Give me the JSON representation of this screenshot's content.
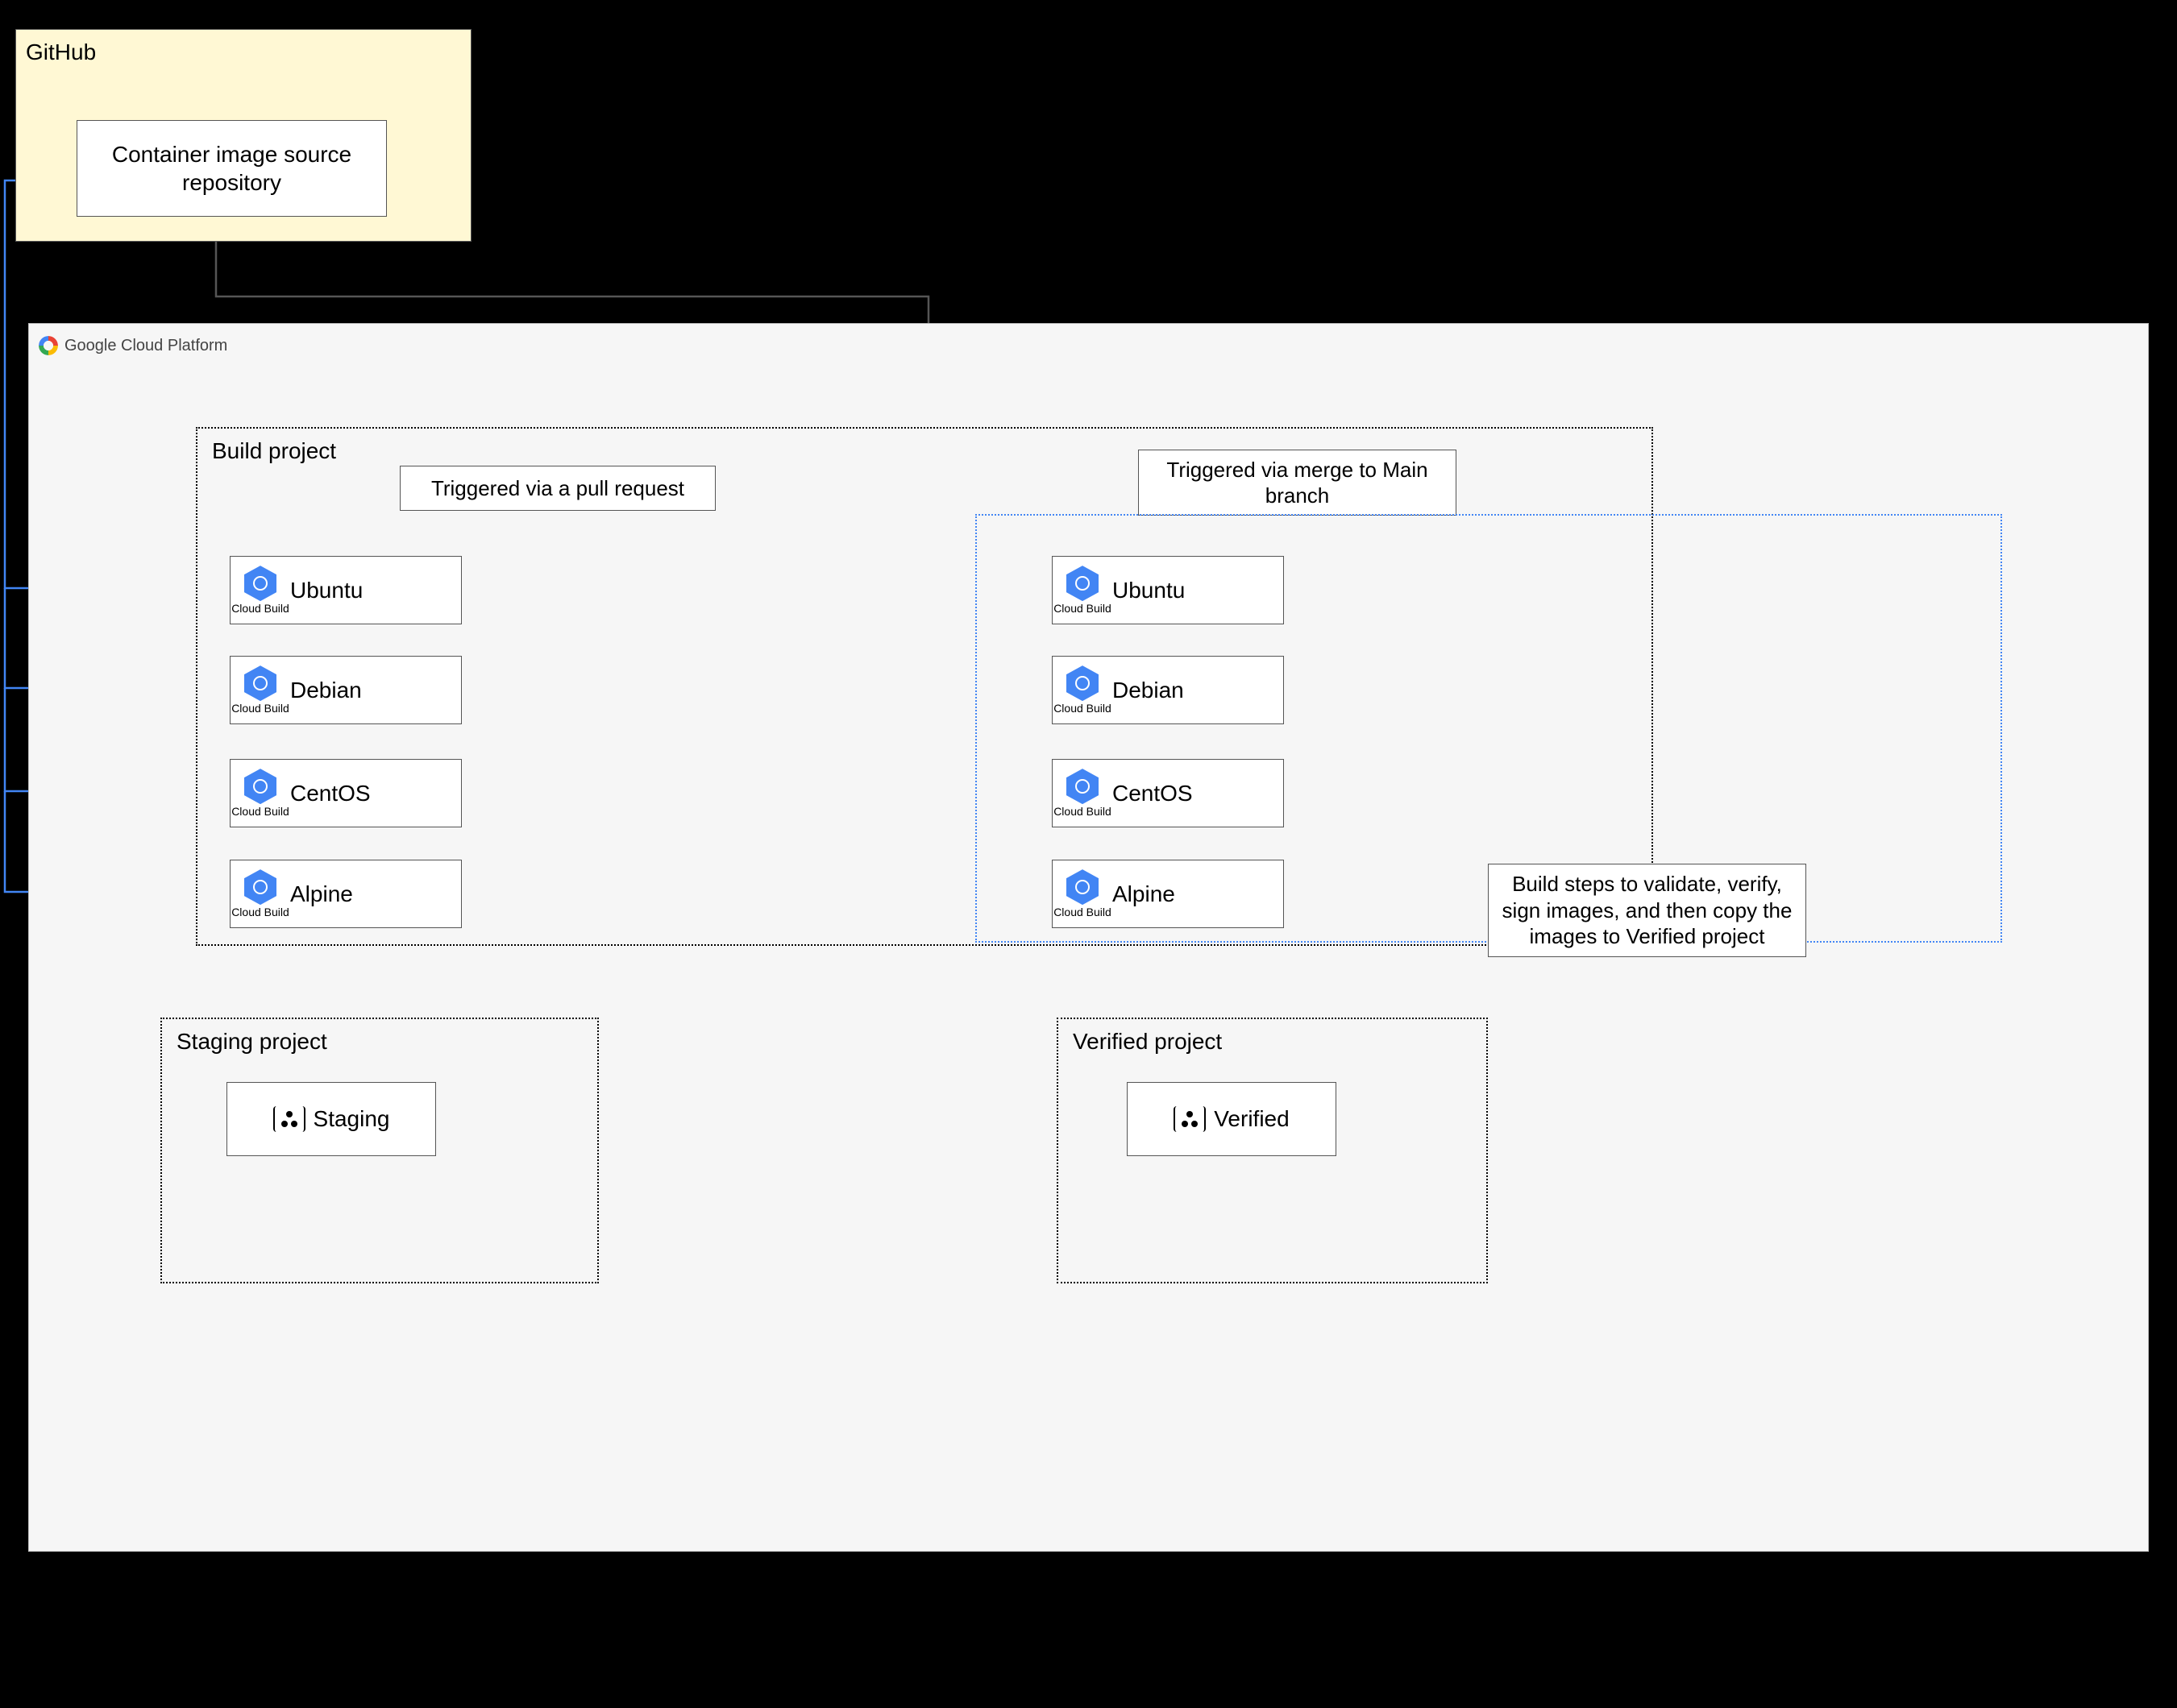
{
  "github": {
    "label": "GitHub",
    "repo_label": "Container image source repository"
  },
  "gcp": {
    "title": "Google Cloud Platform"
  },
  "build_project": {
    "label": "Build project",
    "trigger_pr": "Triggered via a pull request",
    "trigger_merge": "Triggered via merge to Main branch",
    "build_steps": "Build steps to validate, verify, sign images, and then copy the images to Verified project",
    "icon_caption": "Cloud Build",
    "os_pr": [
      "Ubuntu",
      "Debian",
      "CentOS",
      "Alpine"
    ],
    "os_merge": [
      "Ubuntu",
      "Debian",
      "CentOS",
      "Alpine"
    ]
  },
  "staging_project": {
    "label": "Staging project",
    "box": "Staging"
  },
  "verified_project": {
    "label": "Verified project",
    "box": "Verified"
  }
}
